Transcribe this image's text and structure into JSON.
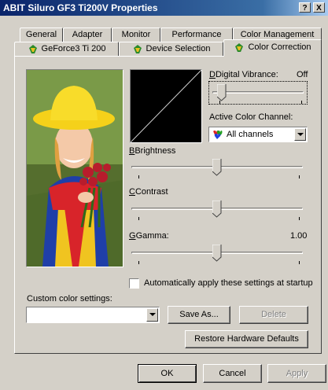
{
  "window": {
    "title": "ABIT Siluro GF3 Ti200V Properties",
    "help_button": "?",
    "close_button": "X"
  },
  "tabs_row1": [
    {
      "label": "General"
    },
    {
      "label": "Adapter"
    },
    {
      "label": "Monitor"
    },
    {
      "label": "Performance"
    },
    {
      "label": "Color Management"
    }
  ],
  "tabs_row2": [
    {
      "label": "GeForce3 Ti 200",
      "icon": "nvidia-icon"
    },
    {
      "label": "Device Selection",
      "icon": "nvidia-icon"
    },
    {
      "label": "Color Correction",
      "icon": "nvidia-icon",
      "active": true
    }
  ],
  "digital_vibrance": {
    "label": "Digital Vibrance:",
    "value": "Off"
  },
  "active_channel": {
    "label": "Active Color Channel:",
    "value": "All channels",
    "icon": "rgb-hearts-icon"
  },
  "brightness": {
    "label": "Brightness",
    "level": 0.5
  },
  "contrast": {
    "label": "Contrast",
    "level": 0.5
  },
  "gamma": {
    "label": "Gamma:",
    "value": "1.00",
    "level": 0.5
  },
  "auto_apply": {
    "label": "Automatically apply these settings at startup",
    "checked": false
  },
  "custom_settings": {
    "label": "Custom color settings:",
    "value": ""
  },
  "buttons": {
    "save_as": "Save As...",
    "delete": "Delete",
    "restore": "Restore Hardware Defaults",
    "ok": "OK",
    "cancel": "Cancel",
    "apply": "Apply"
  }
}
